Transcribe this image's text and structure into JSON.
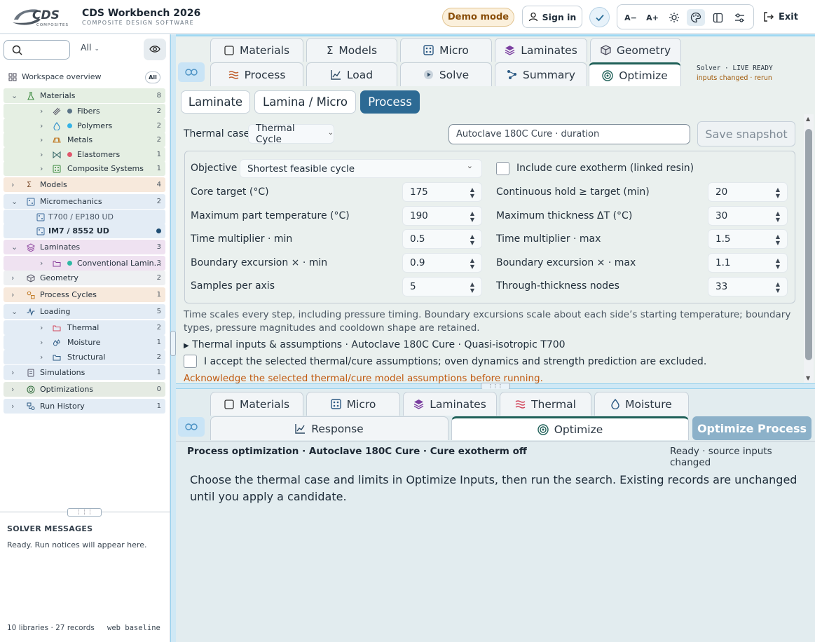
{
  "app": {
    "brand": "CDS",
    "brand_sub": "COMPOSITES",
    "title": "CDS Workbench 2026",
    "subtitle": "COMPOSITE DESIGN SOFTWARE"
  },
  "header": {
    "demo_label": "Demo mode",
    "signin_label": "Sign in",
    "font_down": "A−",
    "font_up": "A+",
    "exit_label": "Exit"
  },
  "sidebar": {
    "filter": "All",
    "workspace": "Workspace overview",
    "workspace_badge": "All",
    "items": [
      {
        "label": "Materials",
        "count": "8"
      },
      {
        "label": "Fibers",
        "count": "2"
      },
      {
        "label": "Polymers",
        "count": "2"
      },
      {
        "label": "Metals",
        "count": "2"
      },
      {
        "label": "Elastomers",
        "count": "1"
      },
      {
        "label": "Composite Systems",
        "count": "1"
      },
      {
        "label": "Models",
        "count": "4"
      },
      {
        "label": "Micromechanics",
        "count": "2"
      },
      {
        "label": "T700 / EP180 UD",
        "count": ""
      },
      {
        "label": "IM7 / 8552 UD",
        "count": ""
      },
      {
        "label": "Laminates",
        "count": "3"
      },
      {
        "label": "Conventional Lamin...",
        "count": "3"
      },
      {
        "label": "Geometry",
        "count": "2"
      },
      {
        "label": "Process Cycles",
        "count": "1"
      },
      {
        "label": "Loading",
        "count": "5"
      },
      {
        "label": "Thermal",
        "count": "2"
      },
      {
        "label": "Moisture",
        "count": "1"
      },
      {
        "label": "Structural",
        "count": "2"
      },
      {
        "label": "Simulations",
        "count": "1"
      },
      {
        "label": "Optimizations",
        "count": "0"
      },
      {
        "label": "Run History",
        "count": "1"
      }
    ],
    "messages_title": "SOLVER MESSAGES",
    "messages_text": "Ready. Run notices will appear here.",
    "footer_left": "10 libraries · 27 records",
    "footer_right": "web baseline"
  },
  "tabs_top": {
    "row1": [
      "Materials",
      "Models",
      "Micro",
      "Laminates",
      "Geometry"
    ],
    "row2": [
      "Process",
      "Load",
      "Solve",
      "Summary",
      "Optimize"
    ],
    "solver_status": "Solver · LIVE READY",
    "solver_note": "inputs changed · rerun"
  },
  "subtabs": [
    "Laminate",
    "Lamina / Micro",
    "Process"
  ],
  "optimize_inputs": {
    "thermal_case_label": "Thermal case",
    "thermal_case_value": "Thermal Cycle",
    "case_name": "Autoclave 180C Cure · duration",
    "snapshot_label": "Save snapshot",
    "objective_label": "Objective",
    "objective_value": "Shortest feasible cycle",
    "exotherm_label": "Include cure exotherm (linked resin)",
    "left": [
      {
        "label": "Core target (°C)",
        "value": "175"
      },
      {
        "label": "Maximum part temperature (°C)",
        "value": "190"
      },
      {
        "label": "Time multiplier · min",
        "value": "0.5"
      },
      {
        "label": "Boundary excursion × · min",
        "value": "0.9"
      },
      {
        "label": "Samples per axis",
        "value": "5"
      }
    ],
    "right": [
      {
        "label": "Continuous hold ≥ target (min)",
        "value": "20"
      },
      {
        "label": "Maximum thickness ΔT (°C)",
        "value": "30"
      },
      {
        "label": "Time multiplier · max",
        "value": "1.5"
      },
      {
        "label": "Boundary excursion × · max",
        "value": "1.1"
      },
      {
        "label": "Through-thickness nodes",
        "value": "33"
      }
    ],
    "note": "Time scales every step, including pressure timing. Boundary excursions scale about each side’s starting temperature; boundary types, pressure magnitudes and cooldown shape are retained.",
    "disclosure": "Thermal inputs & assumptions · Autoclave 180C Cure · Quasi-isotropic T700",
    "accept_label": "I accept the selected thermal/cure assumptions; oven dynamics and strength prediction are excluded.",
    "warning": "Acknowledge the selected thermal/cure model assumptions before running."
  },
  "tabs_bottom": {
    "row1": [
      "Materials",
      "Micro",
      "Laminates",
      "Thermal",
      "Moisture"
    ],
    "row2": [
      "Response",
      "Optimize"
    ],
    "run_label": "Optimize Process"
  },
  "results": {
    "title": "Process optimization · Autoclave 180C Cure · Cure exotherm off",
    "status": "Ready · source inputs changed",
    "body": "Choose the thermal case and limits in Optimize Inputs, then run the search. Existing records are unchanged until you apply a candidate."
  },
  "colors": {
    "accent": "#2d6a94",
    "active_tab_border": "#1f6058",
    "warning": "#c05a10"
  }
}
